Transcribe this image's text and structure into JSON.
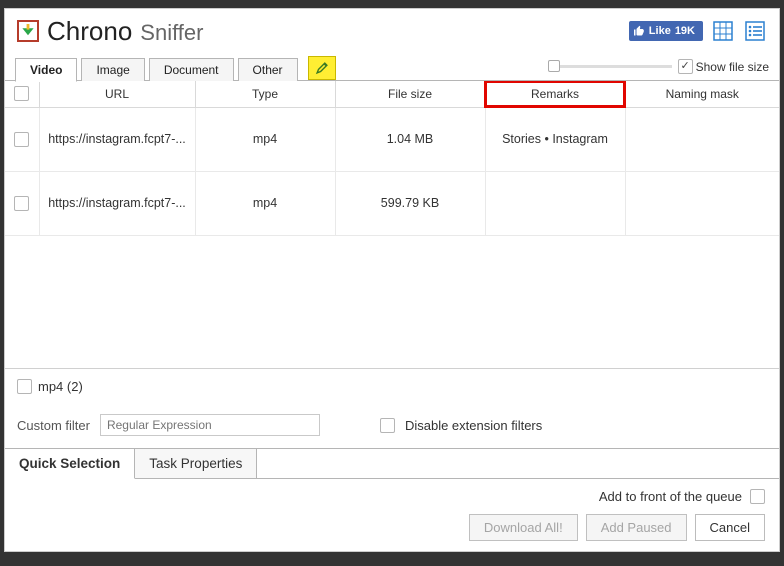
{
  "title": {
    "bold": "Chrono",
    "light": "Sniffer"
  },
  "fb": {
    "label": "Like",
    "count": "19K"
  },
  "show_file_size_label": "Show file size",
  "tabs": {
    "video": "Video",
    "image": "Image",
    "document": "Document",
    "other": "Other"
  },
  "columns": {
    "url": "URL",
    "type": "Type",
    "size": "File size",
    "remarks": "Remarks",
    "naming": "Naming mask"
  },
  "rows": [
    {
      "url": "https://instagram.fcpt7-...",
      "type": "mp4",
      "size": "1.04 MB",
      "remarks": "Stories • Instagram",
      "naming": ""
    },
    {
      "url": "https://instagram.fcpt7-...",
      "type": "mp4",
      "size": "599.79 KB",
      "remarks": "",
      "naming": ""
    }
  ],
  "mp4_filter_label": "mp4 (2)",
  "custom_filter_label": "Custom filter",
  "custom_filter_placeholder": "Regular Expression",
  "disable_ext_label": "Disable extension filters",
  "bottom_tabs": {
    "quick": "Quick Selection",
    "task": "Task Properties"
  },
  "queue_label": "Add to front of the queue",
  "buttons": {
    "download_all": "Download All!",
    "add_paused": "Add Paused",
    "cancel": "Cancel"
  }
}
